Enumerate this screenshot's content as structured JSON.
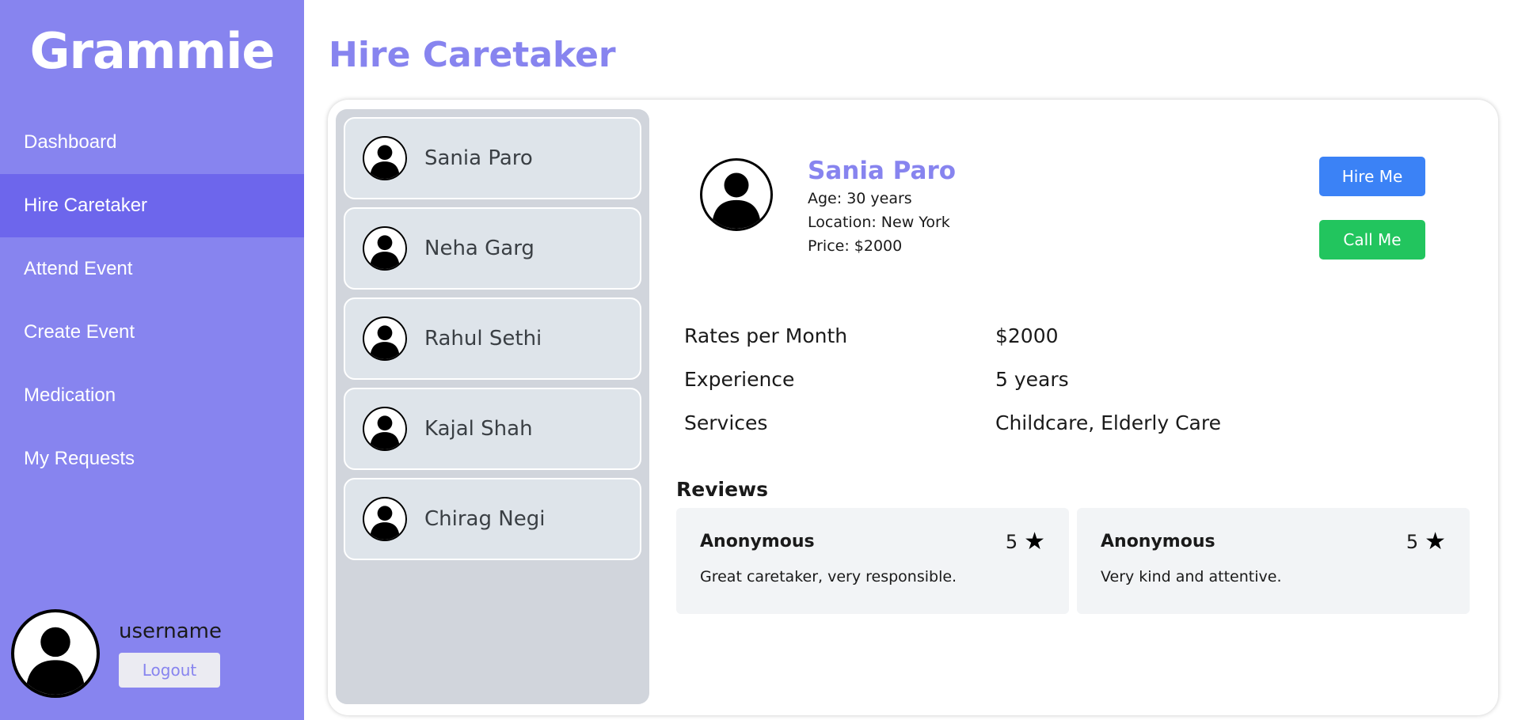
{
  "sidebar": {
    "brand": "Grammie",
    "items": [
      {
        "label": "Dashboard"
      },
      {
        "label": "Hire Caretaker"
      },
      {
        "label": "Attend Event"
      },
      {
        "label": "Create Event"
      },
      {
        "label": "Medication"
      },
      {
        "label": "My Requests"
      }
    ],
    "active_item": "Hire Caretaker",
    "user": {
      "name": "username",
      "logout_label": "Logout"
    }
  },
  "main": {
    "title": "Hire Caretaker",
    "caretakers": [
      {
        "name": "Sania Paro"
      },
      {
        "name": "Neha Garg"
      },
      {
        "name": "Rahul Sethi"
      },
      {
        "name": "Kajal Shah"
      },
      {
        "name": "Chirag Negi"
      }
    ],
    "selected": {
      "name": "Sania Paro",
      "age": "Age: 30 years",
      "location": "Location: New York",
      "price": "Price: $2000",
      "hire_label": "Hire Me",
      "call_label": "Call Me",
      "details": [
        {
          "label": "Rates per Month",
          "value": "$2000"
        },
        {
          "label": "Experience",
          "value": "5 years"
        },
        {
          "label": "Services",
          "value": "Childcare, Elderly Care"
        }
      ]
    },
    "reviews_title": "Reviews",
    "reviews": [
      {
        "author": "Anonymous",
        "rating": "5",
        "text": "Great caretaker, very responsible."
      },
      {
        "author": "Anonymous",
        "rating": "5",
        "text": "Very kind and attentive."
      }
    ]
  },
  "colors": {
    "sidebar_bg": "#8784ef",
    "sidebar_active": "#6d66ec",
    "accent": "#8784ef",
    "hire_button": "#3b82f6",
    "call_button": "#22c55e"
  },
  "icons": {
    "avatar": "person-silhouette-icon",
    "star": "star-icon"
  }
}
